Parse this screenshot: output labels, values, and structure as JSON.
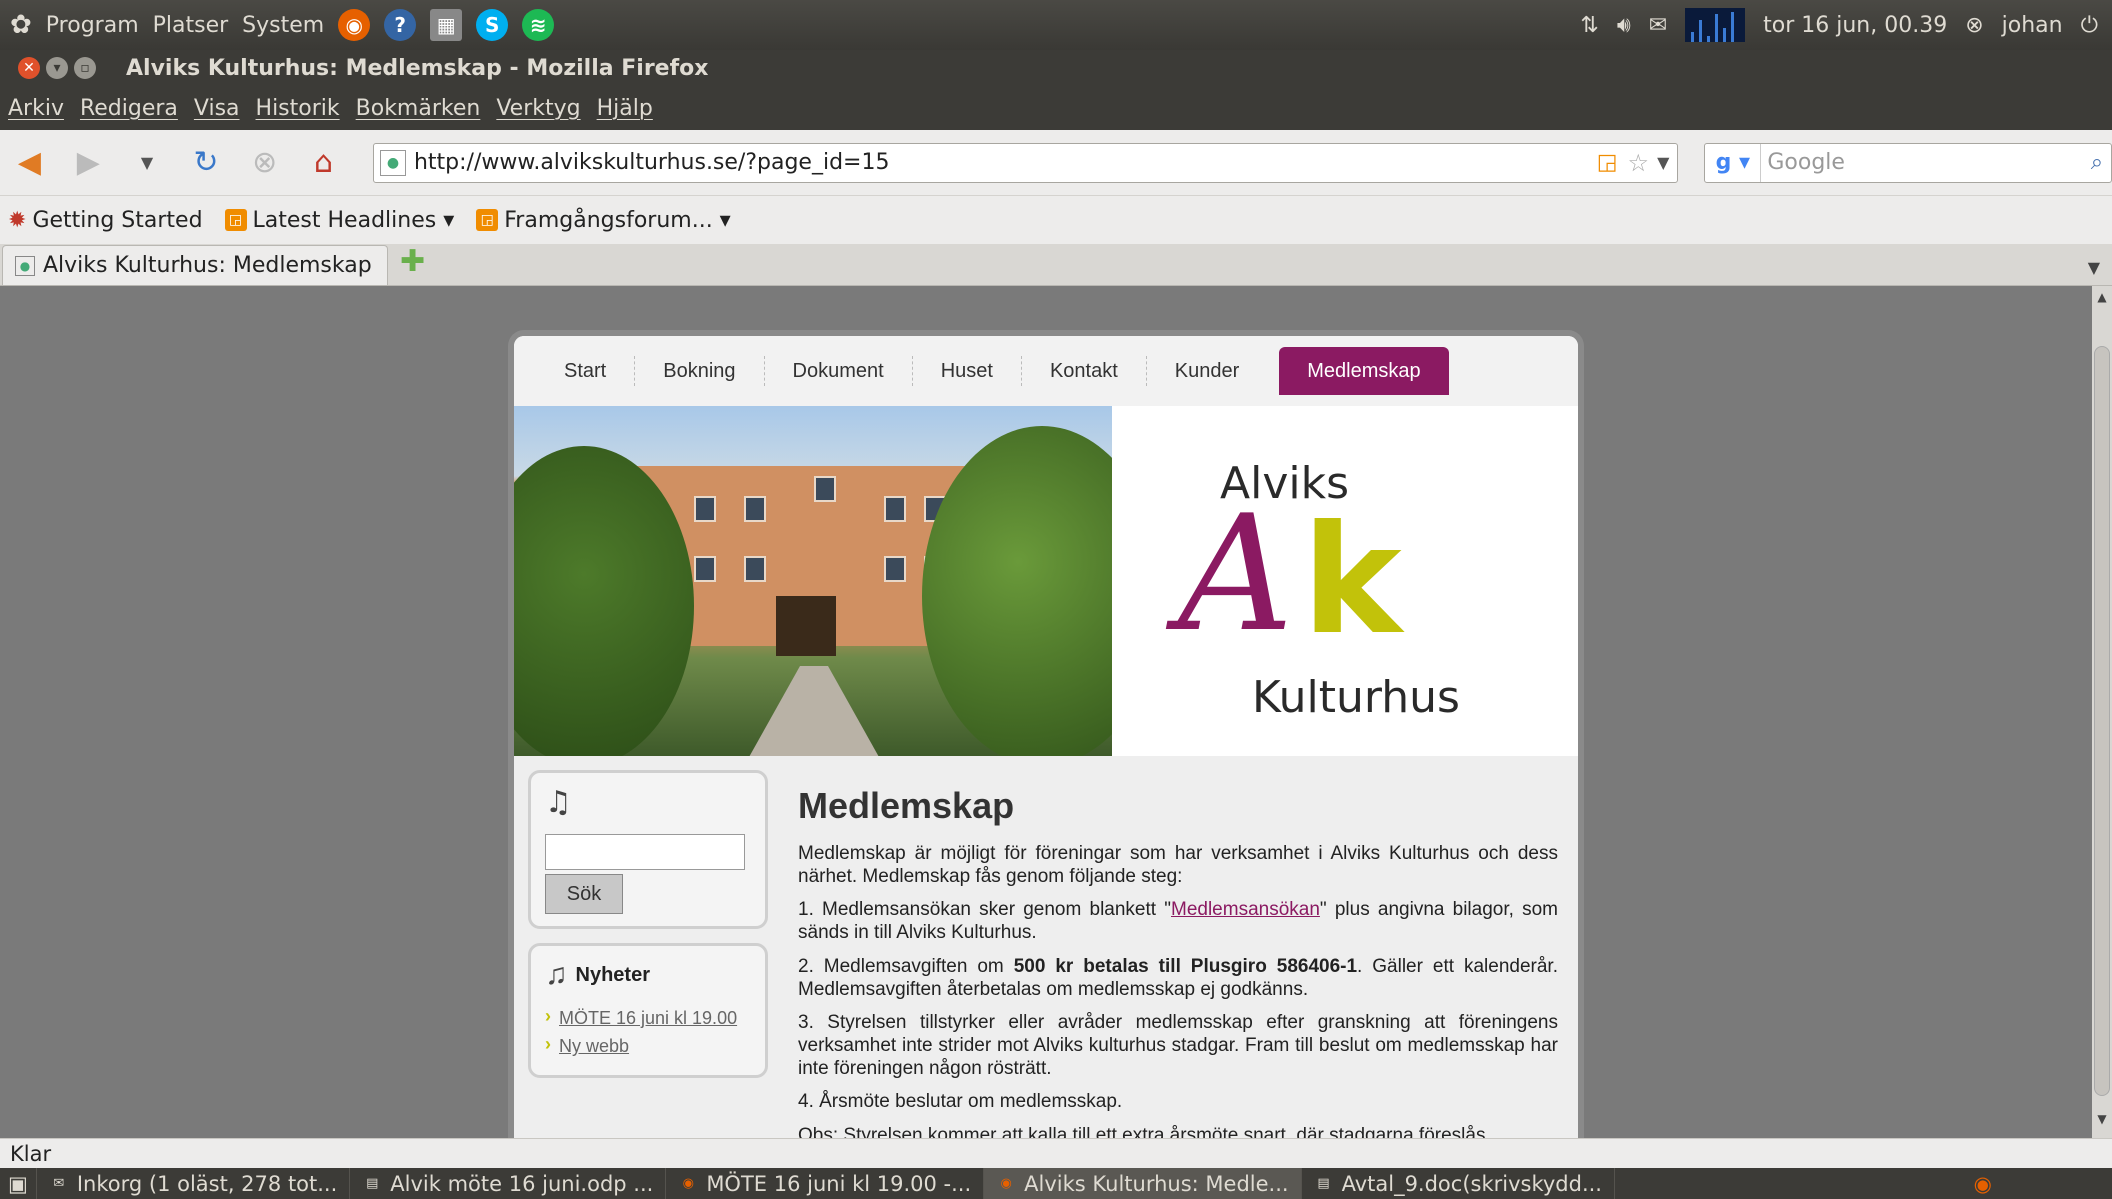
{
  "panel": {
    "menus": [
      "Program",
      "Platser",
      "System"
    ],
    "datetime": "tor 16 jun, 00.39",
    "user": "johan"
  },
  "window": {
    "title": "Alviks Kulturhus: Medlemskap - Mozilla Firefox"
  },
  "menubar": {
    "items": [
      "Arkiv",
      "Redigera",
      "Visa",
      "Historik",
      "Bokmärken",
      "Verktyg",
      "Hjälp"
    ]
  },
  "navbar": {
    "url": "http://www.alvikskulturhus.se/?page_id=15",
    "search_placeholder": "Google"
  },
  "bookmarks": {
    "items": [
      "Getting Started",
      "Latest Headlines ▾",
      "Framgångsforum... ▾"
    ]
  },
  "tab": {
    "title": "Alviks Kulturhus: Medlemskap"
  },
  "site": {
    "nav": [
      "Start",
      "Bokning",
      "Dokument",
      "Huset",
      "Kontakt",
      "Kunder",
      "Medlemskap"
    ],
    "logo": {
      "line1": "Alviks",
      "letter_a": "A",
      "letter_k": "k",
      "line2": "Kulturhus"
    },
    "search_button": "Sök",
    "news_heading": "Nyheter",
    "news_items": [
      "MÖTE 16 juni kl 19.00",
      "Ny webb"
    ],
    "heading": "Medlemskap",
    "intro": "Medlemskap är möjligt för föreningar som har verksamhet i Alviks Kulturhus och dess närhet. Medlemskap fås genom följande steg:",
    "step1_before": "1. Medlemsansökan sker genom blankett \"",
    "step1_link": "Medlemsansökan",
    "step1_after": "\" plus angivna bilagor, som sänds in till Alviks Kulturhus.",
    "step2_before": "2. Medlemsavgiften om ",
    "step2_bold": "500 kr betalas till Plusgiro 586406-1",
    "step2_after": ". Gäller ett kalenderår. Medlemsavgiften återbetalas om medlemsskap ej godkänns.",
    "step3": "3. Styrelsen tillstyrker eller avråder medlemsskap efter granskning att föreningens verksamhet inte strider mot Alviks kulturhus stadgar. Fram till beslut om medlemsskap har inte föreningen någon rösträtt.",
    "step4": "4. Årsmöte beslutar om medlemsskap.",
    "note": "Obs: Styrelsen kommer att kalla till ett extra årsmöte snart, där stadgarna föreslås"
  },
  "statusbar": {
    "text": "Klar"
  },
  "taskbar": {
    "items": [
      "Inkorg (1 oläst, 278 tot...",
      "Alvik möte 16 juni.odp ...",
      "MÖTE 16 juni kl 19.00 -...",
      "Alviks Kulturhus: Medle...",
      "Avtal_9.doc(skrivskydd..."
    ]
  },
  "colors": {
    "accent": "#8b1a62",
    "logo_green": "#c2c20a",
    "panel": "#3c3b37"
  }
}
